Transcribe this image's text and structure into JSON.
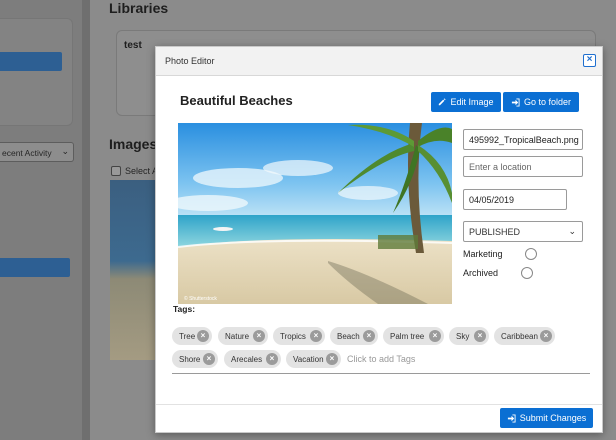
{
  "background": {
    "libraries_heading": "Libraries",
    "library_item": "test",
    "images_heading": "Images",
    "select_all_label": "Select A",
    "activity_select": "ecent Activity"
  },
  "modal": {
    "title": "Photo Editor",
    "close_icon": "close-icon",
    "photo_title": "Beautiful Beaches",
    "edit_button": "Edit Image",
    "folder_button": "Go to folder",
    "filename": "495992_TropicalBeach.png",
    "location_placeholder": "Enter a location",
    "date": "04/05/2019",
    "status": "PUBLISHED",
    "marketing_label": "Marketing",
    "archived_label": "Archived",
    "tags_label": "Tags:",
    "tags": [
      "Tree",
      "Nature",
      "Tropics",
      "Beach",
      "Palm tree",
      "Sky",
      "Caribbean",
      "Shore",
      "Arecales",
      "Vacation"
    ],
    "tag_input_placeholder": "Click to add Tags",
    "submit_button": "Submit Changes"
  },
  "colors": {
    "primary": "#0b6fd3",
    "tag_bg": "#e3e3e3",
    "overlay": "#8a8a8a"
  }
}
